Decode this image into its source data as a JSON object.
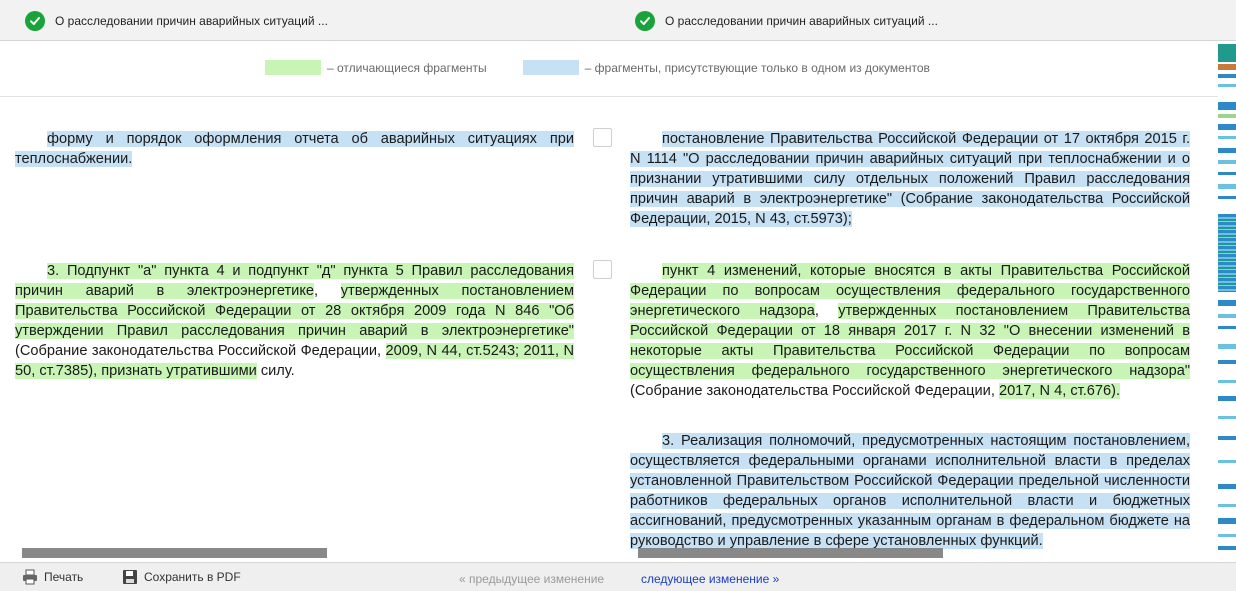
{
  "header": {
    "left_doc_title": "О расследовании причин аварийных ситуаций ...",
    "right_doc_title": "О расследовании причин аварийных ситуаций ..."
  },
  "legend": {
    "changed_label": "– отличающиеся фрагменты",
    "unique_label": "– фрагменты, присутствующие только в одном из документов",
    "changed_color": "#c8f5b6",
    "unique_color": "#c7e1f4"
  },
  "left": {
    "p1": "форму и порядок оформления отчета об аварийных ситуациях при теплоснабжении.",
    "p3": {
      "g1": "3. Подпункт \"а\" пункта 4 и подпункт \"д\" пункта 5 Правил расследования причин аварий в электроэнергетике",
      "t1": ", ",
      "g2": "утвержденных постановлением Правительства Российской Федерации от 28 октября 2009 года N 846 \"Об утверждении Правил расследования причин аварий в электроэнергетике\"",
      "t2": " (Собрание законодательства Российской Федерации, ",
      "g3": "2009, N 44, ст.5243; 2011, N 50, ст.7385), признать утратившими",
      "t3": " силу."
    }
  },
  "right": {
    "p2": "постановление Правительства Российской Федерации от 17 октября 2015 г. N 1114 \"О расследовании причин аварийных ситуаций при теплоснабжении и о признании утратившими силу отдельных положений Правил расследования причин аварий в электроэнергетике\" (Собрание законодательства Российской Федерации, 2015, N 43, ст.5973);",
    "p4": {
      "g1": "пункт 4 изменений, которые вносятся в акты Правительства Российской Федерации по вопросам осуществления федерального государственного энергетического надзора",
      "t1": ", ",
      "g2": "утвержденных постановлением Правительства Российской Федерации от 18 января 2017 г. N 32 \"О внесении изменений в некоторые акты Правительства Российской Федерации по вопросам осуществления федерального государственного энергетического надзора\"",
      "t2": " (Собрание законодательства Российской Федерации, ",
      "g3": "2017, N 4, ст.676).",
      "t3": ""
    },
    "p5": "3. Реализация полномочий, предусмотренных настоящим постановлением, осуществляется федеральными органами исполнительной власти в пределах установленной Правительством Российской Федерации предельной численности работников федеральных органов исполнительной власти и бюджетных ассигнований, предусмотренных указанным органам в федеральном бюджете на руководство и управление в сфере установленных функций."
  },
  "footer": {
    "print_label": "Печать",
    "print_icon": "printer-icon",
    "save_pdf_label": "Сохранить в PDF",
    "save_icon": "floppy-disk-icon",
    "prev_label": "« предыдущее изменение",
    "next_label": "следующее изменение »"
  }
}
